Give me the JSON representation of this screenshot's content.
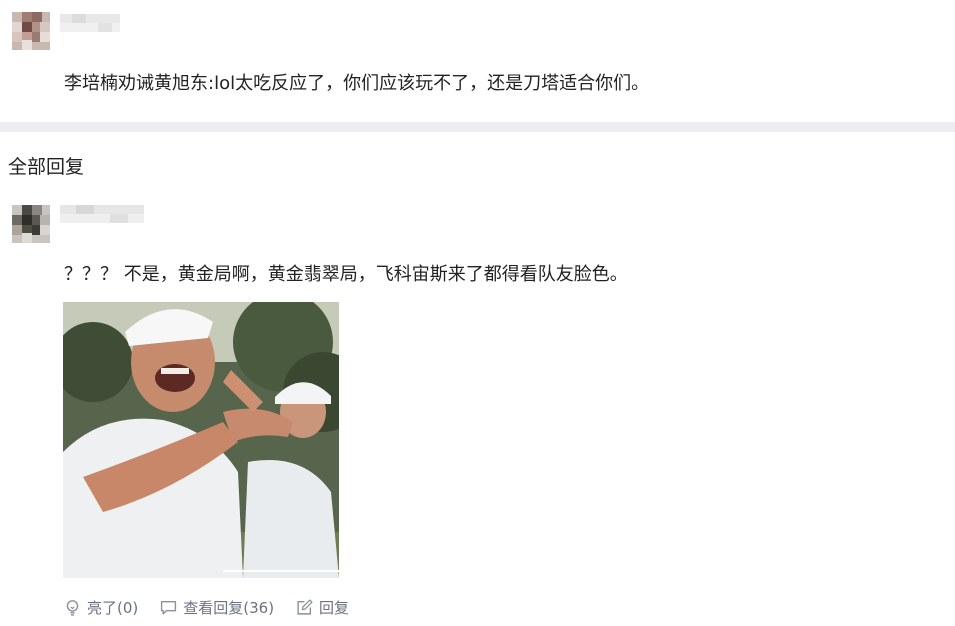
{
  "post": {
    "text": "李培楠劝诫黄旭东:lol太吃反应了，你们应该玩不了，还是刀塔适合你们。"
  },
  "replies_section": {
    "title": "全部回复"
  },
  "reply": {
    "text": "？？？ 不是，黄金局啊，黄金翡翠局，飞科宙斯来了都得看队友脸色。",
    "actions": {
      "like_label": "亮了(0)",
      "view_replies_label": "查看回复(36)",
      "reply_label": "回复"
    }
  },
  "colors": {
    "divider": "#eceef2",
    "action_text": "#6b7280",
    "body_text": "#222222"
  },
  "icons": {
    "like": "lightbulb-icon",
    "view_replies": "comment-icon",
    "reply": "edit-icon"
  }
}
